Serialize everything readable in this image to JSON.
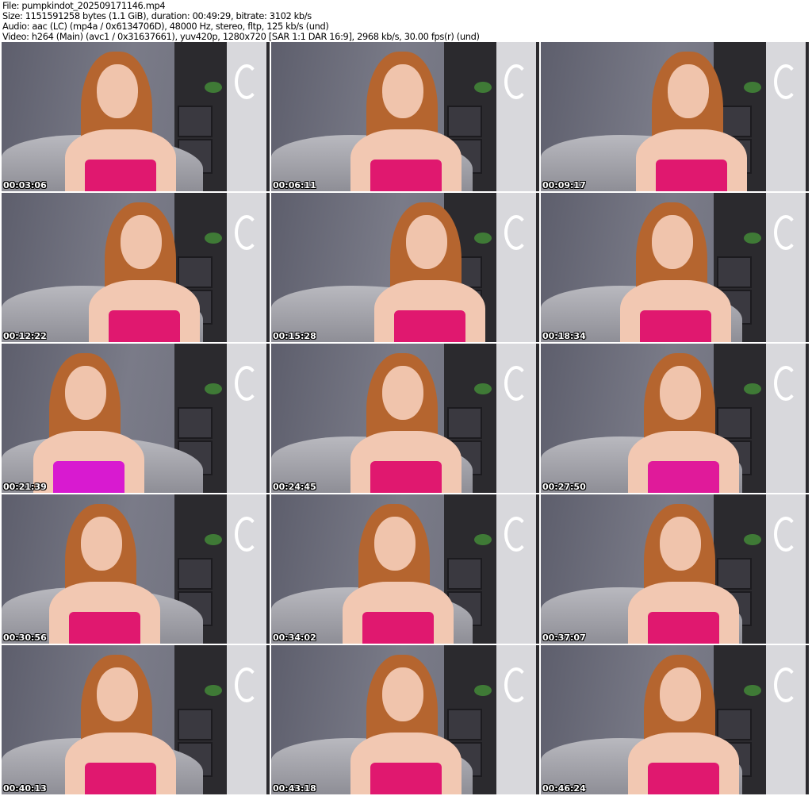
{
  "header": {
    "file": "File: pumpkindot_202509171146.mp4",
    "size": "Size: 1151591258 bytes (1.1 GiB), duration: 00:49:29, bitrate: 3102 kb/s",
    "audio": "Audio: aac (LC) (mp4a / 0x6134706D), 48000 Hz, stereo, fltp, 125 kb/s (und)",
    "video": "Video: h264 (Main) (avc1 / 0x31637661), yuv420p, 1280x720 [SAR 1:1 DAR 16:9], 2968 kb/s, 30.00 fps(r) (und)"
  },
  "thumbnails": [
    {
      "time": "00:03:06",
      "top_color": "#e0186f"
    },
    {
      "time": "00:06:11",
      "top_color": "#e0186f"
    },
    {
      "time": "00:09:17",
      "top_color": "#e0186f"
    },
    {
      "time": "00:12:22",
      "top_color": "#e0186f"
    },
    {
      "time": "00:15:28",
      "top_color": "#e0186f"
    },
    {
      "time": "00:18:34",
      "top_color": "#e0186f"
    },
    {
      "time": "00:21:39",
      "top_color": "#d81ad0"
    },
    {
      "time": "00:24:45",
      "top_color": "#e0186f"
    },
    {
      "time": "00:27:50",
      "top_color": "#e01a9a"
    },
    {
      "time": "00:30:56",
      "top_color": "#e0186f"
    },
    {
      "time": "00:34:02",
      "top_color": "#e0186f"
    },
    {
      "time": "00:37:07",
      "top_color": "#e0186f"
    },
    {
      "time": "00:40:13",
      "top_color": "#e0186f"
    },
    {
      "time": "00:43:18",
      "top_color": "#e0186f"
    },
    {
      "time": "00:46:24",
      "top_color": "#e0186f"
    }
  ]
}
